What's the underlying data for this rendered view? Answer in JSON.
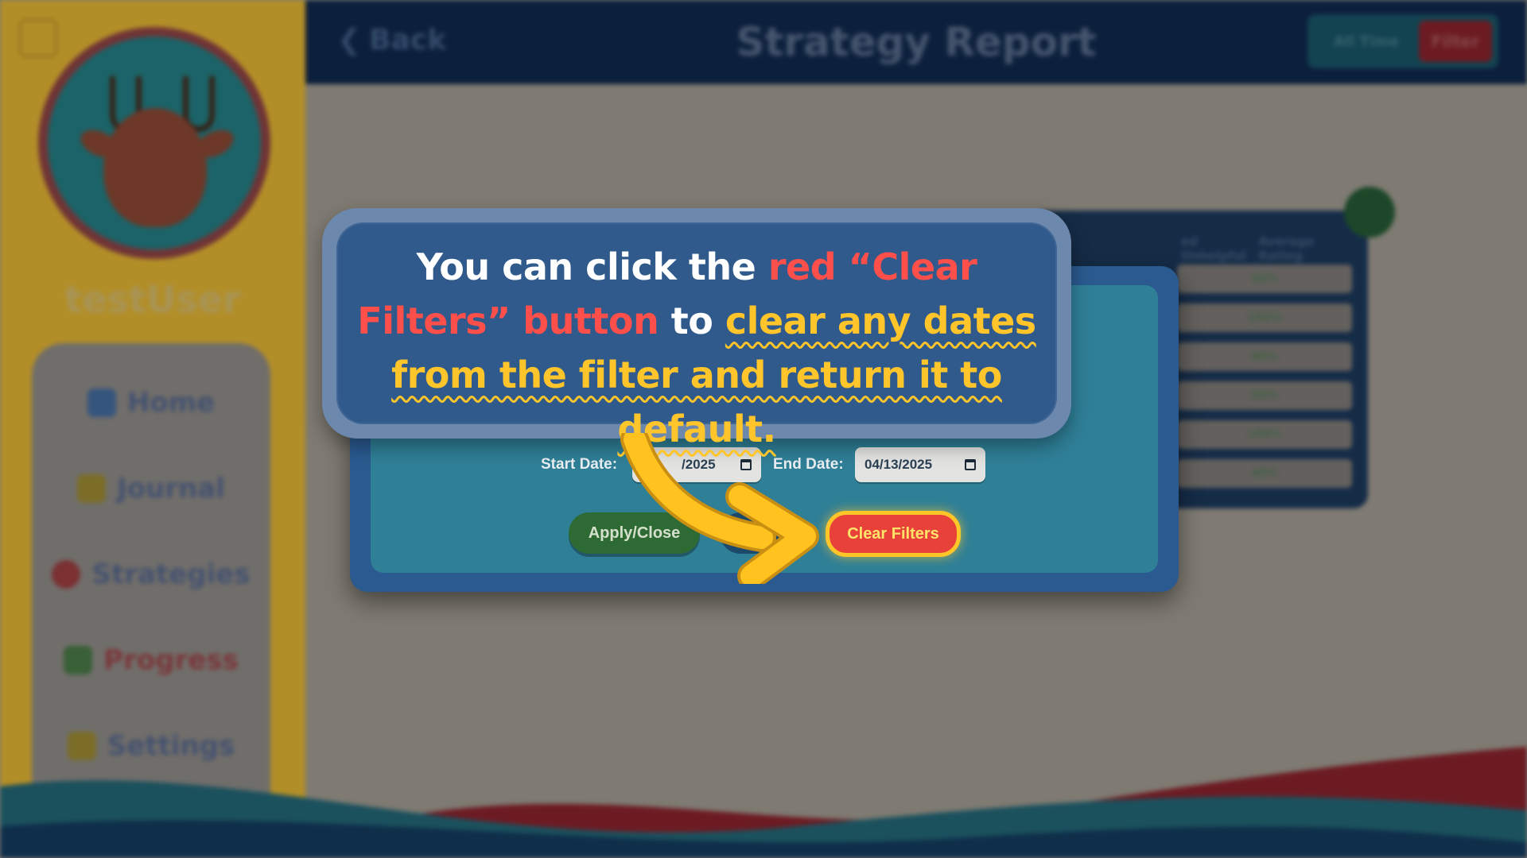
{
  "sidebar": {
    "username": "testUser",
    "nav_items": [
      {
        "label": "Home",
        "icon": "home-icon"
      },
      {
        "label": "Journal",
        "icon": "pencil-icon"
      },
      {
        "label": "Strategies",
        "icon": "lightbulb-icon"
      },
      {
        "label": "Progress",
        "icon": "chart-icon"
      },
      {
        "label": "Settings",
        "icon": "gear-icon"
      }
    ],
    "active_item": "Progress"
  },
  "header": {
    "back_label": "Back",
    "title": "Strategy Report",
    "range_label": "All Time",
    "filter_label": "Filter"
  },
  "table": {
    "headers": [
      "ed Unhelpful",
      "Average Rating"
    ],
    "rows": [
      "50%",
      "100%",
      "40%",
      "50%",
      "100%",
      "40%"
    ]
  },
  "filter_modal": {
    "start_label": "Start Date:",
    "start_value": "/2025",
    "end_label": "End Date:",
    "end_value": "04/13/2025",
    "apply_label": "Apply/Close",
    "clear_label": "Clear Filters"
  },
  "callout": {
    "part1": "You can click the ",
    "part2": "red “Clear Filters” button",
    "part3": " to ",
    "part4": "clear any dates from the filter and return it to default."
  },
  "colors": {
    "clear_button": "#e8413a",
    "clear_button_border": "#ffc62a",
    "highlight_red": "#ff4f4a",
    "highlight_yellow": "#ffc52a",
    "callout_bg": "#305a8c",
    "arrow": "#ffc21f"
  }
}
